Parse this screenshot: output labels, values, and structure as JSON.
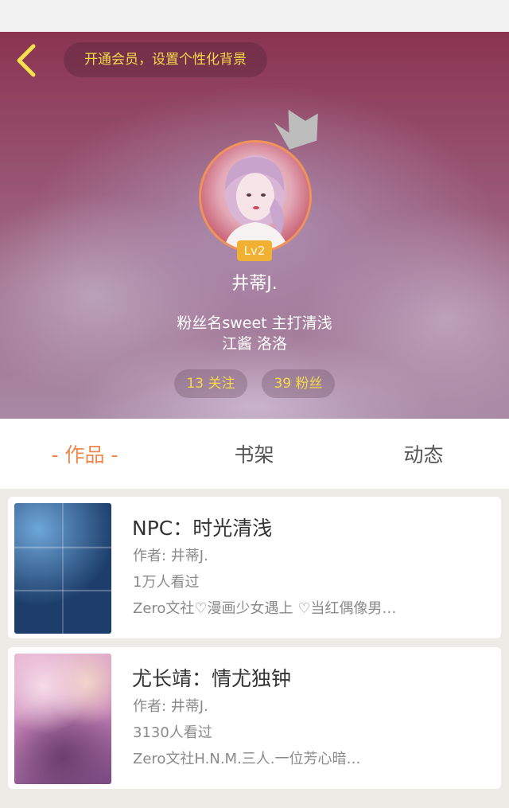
{
  "header": {
    "vip_prompt": "开通会员，设置个性化背景",
    "level": "Lv2",
    "username": "井蒂J.",
    "bio_line1": "粉丝名sweet  主打清浅",
    "bio_line2": "江酱 洛洛",
    "following": "13 关注",
    "fans": "39 粉丝",
    "accent_color": "#f6d84a"
  },
  "tabs": {
    "works": "- 作品 -",
    "bookshelf": "书架",
    "feed": "动态",
    "active_color": "#f0874a"
  },
  "works": [
    {
      "title": "NPC：时光清浅",
      "author": "作者: 井蒂J.",
      "views": "1万人看过",
      "desc": "Zero文社♡漫画少女遇上 ♡当红偶像男…"
    },
    {
      "title": "尤长靖：情尤独钟",
      "author": "作者: 井蒂J.",
      "views": "3130人看过",
      "desc": "Zero文社H.N.M.三人.一位芳心暗…"
    }
  ],
  "icons": {
    "back": "chevron-left-icon",
    "crown": "crown-icon"
  }
}
